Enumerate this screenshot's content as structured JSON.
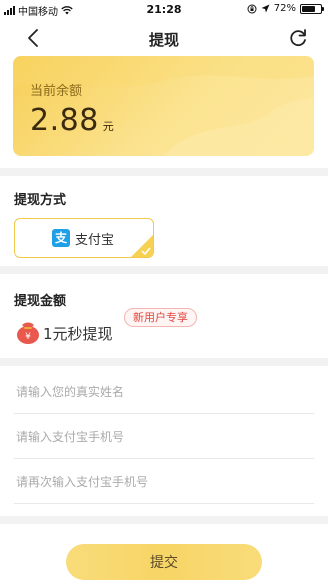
{
  "status_bar": {
    "carrier": "中国移动",
    "time": "21:28",
    "battery": "72%",
    "battery_level": 0.72
  },
  "nav": {
    "title": "提现"
  },
  "balance": {
    "label": "当前余额",
    "amount": "2.88",
    "unit": "元"
  },
  "method": {
    "title": "提现方式",
    "option_label": "支付宝",
    "logo_glyph": "支"
  },
  "amount": {
    "title": "提现金额",
    "option_label": "1元秒提现",
    "badge": "新用户专享"
  },
  "form": {
    "name_placeholder": "请输入您的真实姓名",
    "phone_placeholder": "请输入支付宝手机号",
    "phone_confirm_placeholder": "请再次输入支付宝手机号"
  },
  "submit": {
    "label": "提交"
  },
  "colors": {
    "accent": "#f7cf57",
    "alipay_blue": "#1e9fe8",
    "badge_red": "#e2473c"
  }
}
